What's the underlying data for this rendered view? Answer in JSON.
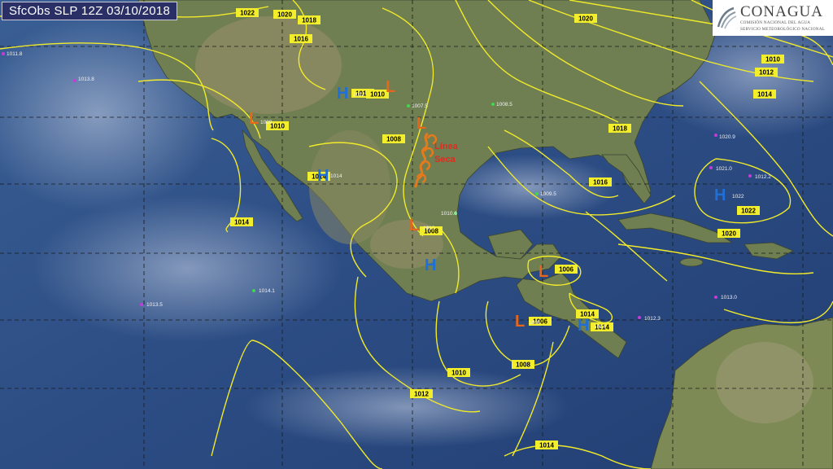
{
  "title": "SfcObs SLP 12Z 03/10/2018",
  "logo": {
    "brand": "CONAGUA",
    "line1": "COMISIÓN NACIONAL DEL AGUA",
    "line2": "SERVICIO METEOROLÓGICO NACIONAL"
  },
  "colors": {
    "ocean": "#2d4f86",
    "land": "#6f7f52",
    "isobar": "#f1ea2a",
    "high": "#1f6fd6",
    "low": "#e8661a",
    "front": "#e57a1c"
  },
  "isobar_labels": [
    "1022",
    "1020",
    "1018",
    "1016",
    "1010",
    "1012",
    "1008",
    "1014",
    "1006",
    "1012",
    "1010",
    "1008",
    "1014",
    "1016",
    "1018",
    "1020",
    "1022",
    "1010",
    "1012",
    "1014",
    "1014",
    "1010",
    "1008",
    "1006",
    "1014",
    "1014",
    "1020"
  ],
  "centers": [
    {
      "type": "H"
    },
    {
      "type": "L"
    },
    {
      "type": "L"
    },
    {
      "type": "L"
    },
    {
      "type": "H"
    },
    {
      "type": "L"
    },
    {
      "type": "H"
    },
    {
      "type": "L"
    },
    {
      "type": "L"
    },
    {
      "type": "H"
    },
    {
      "type": "H"
    }
  ],
  "center_pressures": [
    "1012",
    "1009",
    "1014",
    "1010",
    "1006",
    "1014",
    "1022"
  ],
  "front": {
    "line1": "Línea",
    "line2": "Seca"
  },
  "station_values": [
    "1013.8",
    "1011.8",
    "1013.5",
    "1014.1",
    "1013.0",
    "1012.3",
    "1021.0",
    "1020.9",
    "1012.2",
    "1007.5",
    "1009.5",
    "1008.5",
    "1010.6"
  ]
}
